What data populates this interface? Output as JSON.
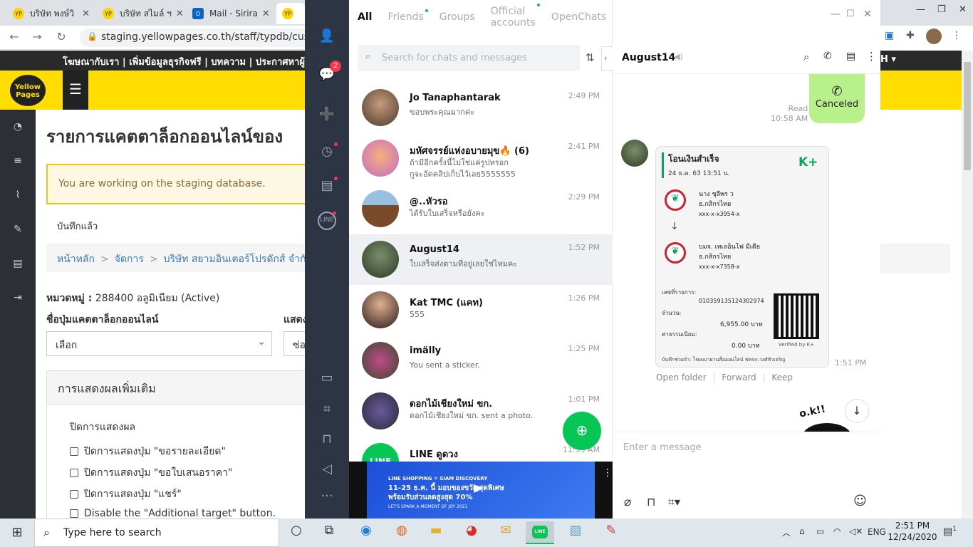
{
  "browser": {
    "tabs": [
      {
        "label": "บริษัท พงษ์วิ"
      },
      {
        "label": "บริษัท สไมล์ ฯ"
      },
      {
        "label": "Mail - Sirira"
      },
      {
        "label": ""
      }
    ],
    "url": "staging.yellowpages.co.th/staff/typdb/custome"
  },
  "yp": {
    "topbar": "โฆษณากับเรา | เพิ่มข้อมูลธุรกิจฟรี | บทความ | ประกาศหาผู้",
    "logo_line1": "Yellow",
    "logo_line2": "Pages",
    "page_title": "รายการแคตตาล็อกออนไลน์ของ",
    "warning": "You are working on the staging database.",
    "saved": "บันทึกแล้ว",
    "breadcrumb": [
      "หน้าหลัก",
      "จัดการ",
      "บริษัท สยามอินเตอร์โปรดักส์ จำกัด"
    ],
    "category_label": "หมวดหมู่ :",
    "category_value": "288400 อลูมิเนียม (Active)",
    "field_label": "ชื่อปุ่มแคตตาล็อกออนไลน์",
    "field2_label": "แสดง",
    "select_value": "เลือก",
    "select2_value": "ซ่อ",
    "section_title": "การแสดงผลเพิ่มเติม",
    "sub_title": "ปิดการแสดงผล",
    "checks": [
      "ปิดการแสดงปุ่ม \"ขอรายละเอียด\"",
      "ปิดการแสดงปุ่ม \"ขอใบเสนอราคา\"",
      "ปิดการแสดงปุ่ม \"แชร์\"",
      "Disable the \"Additional target\" button."
    ]
  },
  "line": {
    "chat_badge": "2",
    "filters": [
      "All",
      "Friends",
      "Groups",
      "Official accounts",
      "OpenChats"
    ],
    "search_placeholder": "Search for chats and messages",
    "chats": [
      {
        "name": "Jo Tanaphantarak",
        "msg": "ขอบพระคุณมากค่ะ",
        "msg2": "",
        "time": "2:49 PM"
      },
      {
        "name": "มหัศจรรย์แห่งอบายมุข🔥 (6)",
        "msg": "ถ้ามีอีกครั้งนี้ไม่ใช่แค่รูปหรอก",
        "msg2": "กูจะอัดคลิปเก็บไว้เลย5555555",
        "time": "2:41 PM"
      },
      {
        "name": "@..หัวรอ",
        "msg": "ได้รับใบเสร็จหรือยังคะ",
        "msg2": "",
        "time": "2:29 PM"
      },
      {
        "name": "August14",
        "msg": "ใบเสร็จส่งตามที่อยู่เลยใช่ไหมคะ",
        "msg2": "",
        "time": "1:52 PM"
      },
      {
        "name": "Kat TMC (แคท)",
        "msg": "555",
        "msg2": "",
        "time": "1:26 PM"
      },
      {
        "name": "imälly",
        "msg": "You sent a sticker.",
        "msg2": "",
        "time": "1:25 PM"
      },
      {
        "name": "ดอกไม้เชียงใหม่ ขก.",
        "msg": "ดอกไม้เชียงใหม่ ขก. sent a photo.",
        "msg2": "",
        "time": "1:01 PM"
      },
      {
        "name": "LINE ดูดวง",
        "msg": "",
        "msg2": "",
        "time": "11:53 AM"
      }
    ],
    "ad_line1": "LINE SHOPPING ✕ SIAM DISCOVERY",
    "ad_line2": "11-25 ธ.ค. นี้ มอบของขวัญสุดพิเศษ",
    "ad_line3": "พร้อมรับส่วนลดสูงสุด 70%",
    "ad_line4": "LET'S SPARK A MOMENT OF JOY 2021",
    "chat_title": "August14",
    "call_label": "Canceled",
    "read_label": "Read",
    "read_time": "10:58 AM",
    "slip": {
      "title": "โอนเงินสำเร็จ",
      "date": "24 ธ.ค. 63  13:51 น.",
      "brand": "K+",
      "from_name": "นาง ชุลีพร ว",
      "from_bank": "ธ.กสิกรไทย",
      "from_acct": "xxx-x-x3954-x",
      "to_name": "บมจ. เทเลอินโฟ มีเดีย",
      "to_bank": "ธ.กสิกรไทย",
      "to_acct": "xxx-x-x7358-x",
      "ref_label": "เลขที่รายการ:",
      "ref": "010359135124302974",
      "amount_label": "จำนวน:",
      "amount": "6,955.00 บาท",
      "fee_label": "ค่าธรรมเนียม:",
      "fee": "0.00 บาท",
      "memo": "บันทึกช่วยจำ: โฆษณาผ่านสื่อออนไลน์ ฟหจก.วงศ์ทิวเจริญ",
      "verified": "Verified by K+"
    },
    "slip_time": "1:51 PM",
    "slip_actions": [
      "Open folder",
      "Forward",
      "Keep"
    ],
    "composer_placeholder": "Enter a message"
  },
  "taskbar": {
    "search_placeholder": "Type here to search",
    "lang": "ENG",
    "time": "2:51 PM",
    "date": "12/24/2020",
    "notif": "1"
  }
}
